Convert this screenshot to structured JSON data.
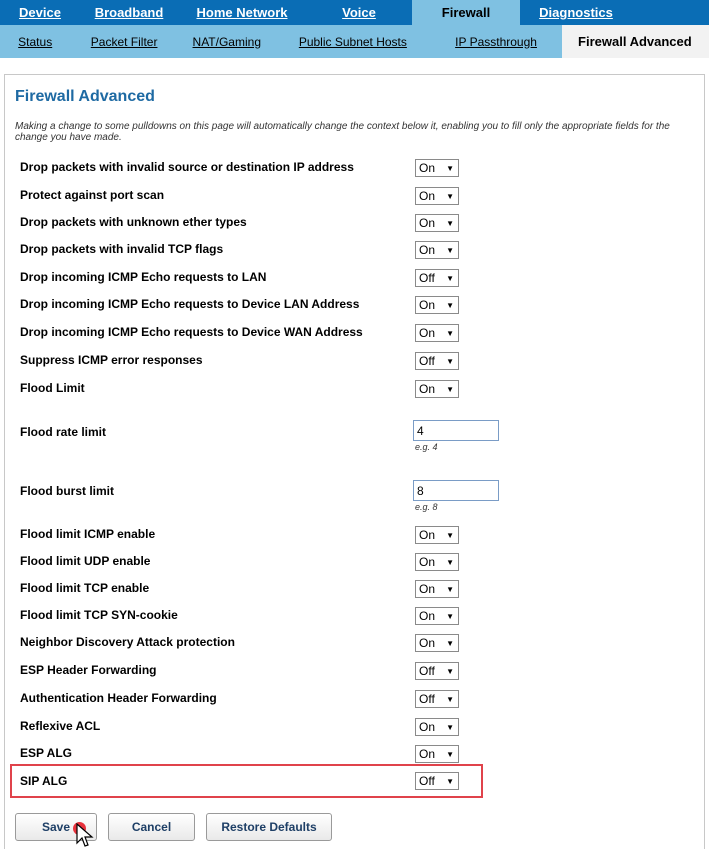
{
  "top_nav": [
    {
      "label": "Device",
      "active": false
    },
    {
      "label": "Broadband",
      "active": false
    },
    {
      "label": "Home Network",
      "active": false
    },
    {
      "label": "Voice",
      "active": false
    },
    {
      "label": "Firewall",
      "active": true
    },
    {
      "label": "Diagnostics",
      "active": false
    }
  ],
  "sub_nav": [
    {
      "label": "Status",
      "active": false
    },
    {
      "label": "Packet Filter",
      "active": false
    },
    {
      "label": "NAT/Gaming",
      "active": false
    },
    {
      "label": "Public Subnet Hosts",
      "active": false
    },
    {
      "label": "IP Passthrough",
      "active": false
    },
    {
      "label": "Firewall Advanced",
      "active": true
    }
  ],
  "page": {
    "title": "Firewall Advanced",
    "intro": "Making a change to some pulldowns on this page will automatically change the context below it, enabling you to fill only the appropriate fields for the change you have made."
  },
  "settings": [
    {
      "label": "Drop packets with invalid source or destination IP address",
      "value": "On"
    },
    {
      "label": "Protect against port scan",
      "value": "On"
    },
    {
      "label": "Drop packets with unknown ether types",
      "value": "On"
    },
    {
      "label": "Drop packets with invalid TCP flags",
      "value": "On"
    },
    {
      "label": "Drop incoming ICMP Echo requests to LAN",
      "value": "Off"
    },
    {
      "label": "Drop incoming ICMP Echo requests to Device LAN Address",
      "value": "On"
    },
    {
      "label": "Drop incoming ICMP Echo requests to Device WAN Address",
      "value": "On"
    },
    {
      "label": "Suppress ICMP error responses",
      "value": "Off"
    },
    {
      "label": "Flood Limit",
      "value": "On"
    },
    {
      "label": "Flood rate limit",
      "value": "4",
      "hint": "e.g. 4"
    },
    {
      "label": "Flood burst limit",
      "value": "8",
      "hint": "e.g. 8"
    },
    {
      "label": "Flood limit ICMP enable",
      "value": "On"
    },
    {
      "label": "Flood limit UDP enable",
      "value": "On"
    },
    {
      "label": "Flood limit TCP enable",
      "value": "On"
    },
    {
      "label": "Flood limit TCP SYN-cookie",
      "value": "On"
    },
    {
      "label": "Neighbor Discovery Attack protection",
      "value": "On"
    },
    {
      "label": "ESP Header Forwarding",
      "value": "Off"
    },
    {
      "label": "Authentication Header Forwarding",
      "value": "Off"
    },
    {
      "label": "Reflexive ACL",
      "value": "On"
    },
    {
      "label": "ESP ALG",
      "value": "On"
    },
    {
      "label": "SIP ALG",
      "value": "Off"
    }
  ],
  "buttons": {
    "save": "Save",
    "cancel": "Cancel",
    "restore": "Restore Defaults"
  },
  "icons": {
    "dropdown": "caret-down-icon",
    "cursor": "mouse-pointer-icon"
  },
  "colors": {
    "nav": "#0a6db5",
    "subnav": "#7fc1e2",
    "title": "#1e6aa3",
    "highlight": "#e0434b"
  }
}
